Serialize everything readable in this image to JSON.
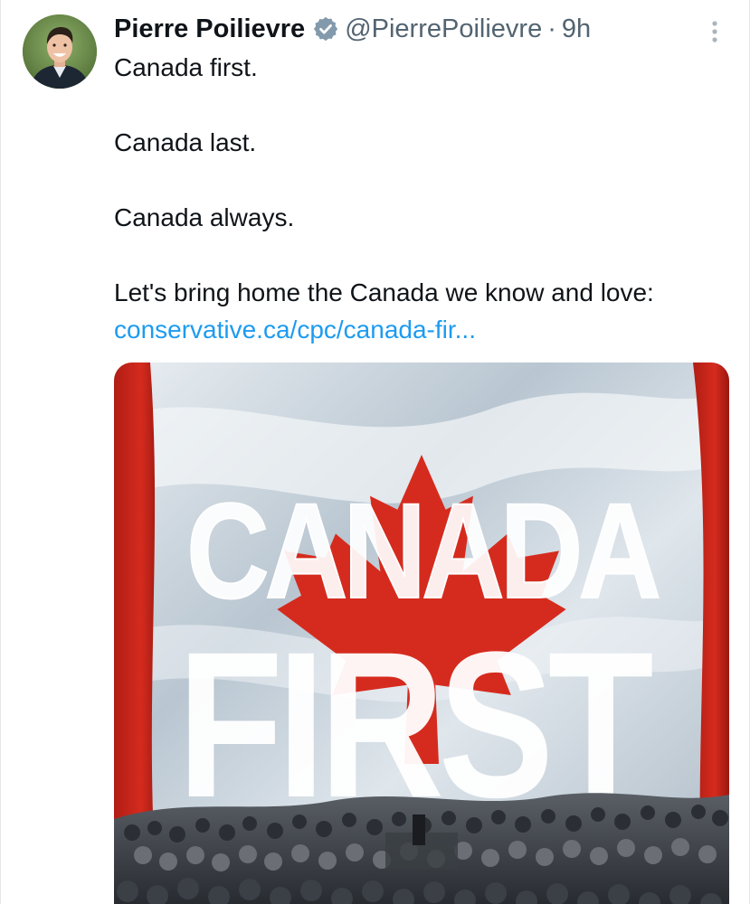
{
  "tweet": {
    "author_name": "Pierre Poilievre",
    "handle": "@PierrePoilievre",
    "separator": "·",
    "time": "9h",
    "lines": [
      "Canada first.",
      "Canada last.",
      "Canada always."
    ],
    "closing_text": "Let's bring home the Canada we know and love: ",
    "link_text": "conservative.ca/cpc/canada-fir..."
  },
  "media": {
    "poster_word_1": "CANADA",
    "poster_word_2": "FIRST"
  },
  "icons": {
    "verified": "verified-badge-icon",
    "more": "more-options-icon",
    "avatar": "profile-photo"
  },
  "colors": {
    "link": "#1d9bf0",
    "secondary_text": "#536471",
    "flag_red": "#d52b1e",
    "primary_text": "#0f1419"
  }
}
